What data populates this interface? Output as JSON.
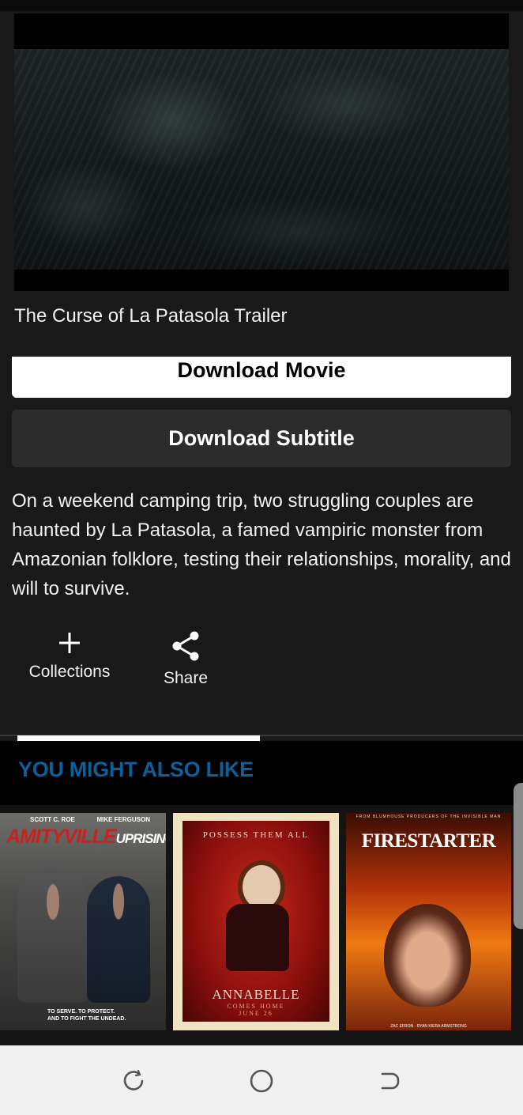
{
  "video": {
    "title": "The Curse of La Patasola Trailer"
  },
  "buttons": {
    "download_movie": "Download Movie",
    "download_subtitle": "Download Subtitle"
  },
  "synopsis": "On a weekend camping trip, two struggling couples are haunted by La Patasola, a famed vampiric monster from Amazonian folklore, testing their relationships, morality, and will to survive.",
  "actions": {
    "collections": {
      "label": "Collections",
      "icon": "plus-icon"
    },
    "share": {
      "label": "Share",
      "icon": "share-icon"
    }
  },
  "recommendations": {
    "heading": "YOU MIGHT ALSO LIKE",
    "heading_color": "#0b5f9a",
    "items": [
      {
        "title": "AMITYVILLE",
        "title_suffix": "UPRISING",
        "actor_left": "SCOTT C. ROE",
        "actor_right": "MIKE FERGUSON",
        "tagline_1": "TO SERVE. TO PROTECT.",
        "tagline_2": "AND TO FIGHT THE UNDEAD."
      },
      {
        "title": "ANNABELLE",
        "tagline": "POSSESS THEM ALL",
        "subtitle": "COMES HOME",
        "date": "JUNE 26"
      },
      {
        "title": "FIRESTARTER",
        "top_credit": "FROM BLUMHOUSE PRODUCERS OF THE INVISIBLE MAN",
        "bottom_credit": "ZAC EFRON · RYAN KIERA ARMSTRONG"
      }
    ]
  },
  "colors": {
    "background": "#191919",
    "button_primary_bg": "#ffffff",
    "button_secondary_bg": "#2c2c2c",
    "nav_bar_bg": "#f0f0f0"
  },
  "navigation": {
    "recent": "recent-apps-icon",
    "home": "home-icon",
    "back": "back-icon"
  }
}
